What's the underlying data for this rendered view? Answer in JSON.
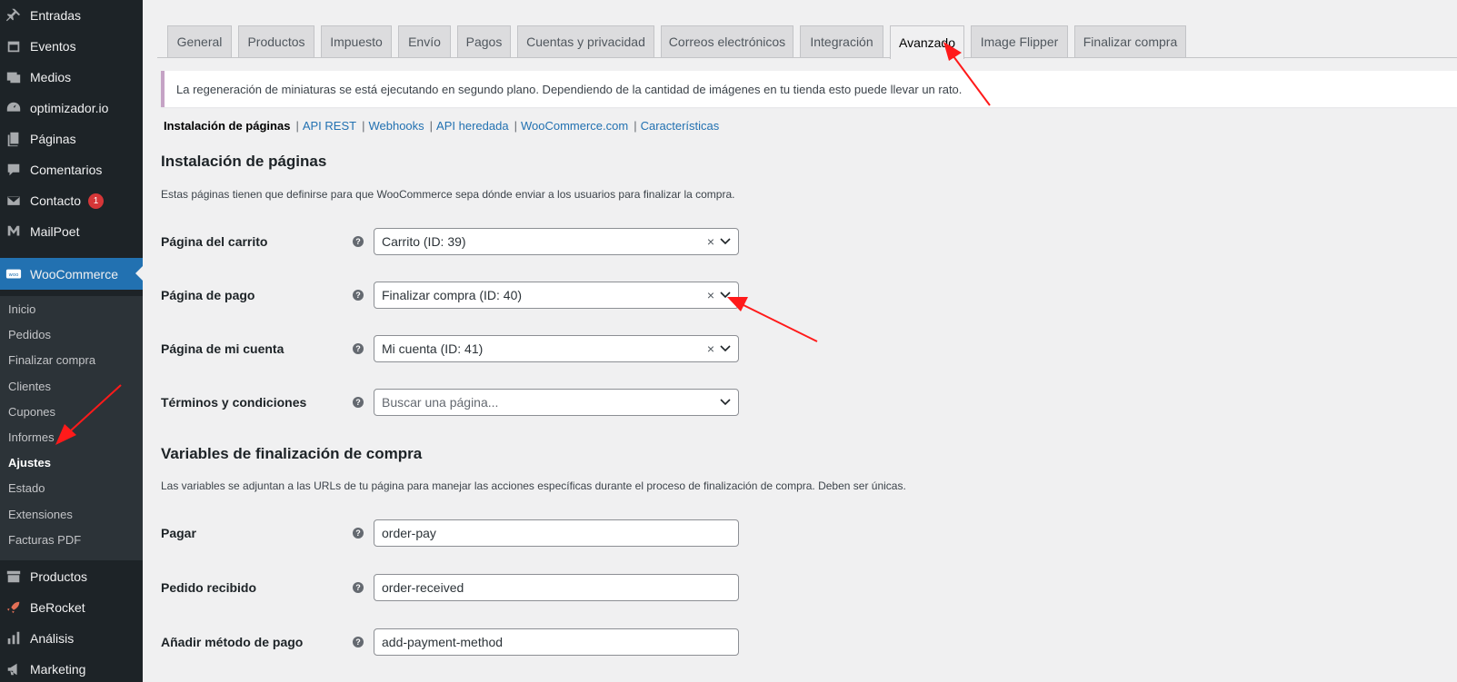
{
  "sidebar": {
    "items": [
      {
        "label": "Entradas",
        "icon": "pin-icon"
      },
      {
        "label": "Eventos",
        "icon": "calendar-icon"
      },
      {
        "label": "Medios",
        "icon": "media-icon"
      },
      {
        "label": "optimizador.io",
        "icon": "gauge-icon"
      },
      {
        "label": "Páginas",
        "icon": "pages-icon"
      },
      {
        "label": "Comentarios",
        "icon": "comment-icon"
      },
      {
        "label": "Contacto",
        "icon": "mail-icon",
        "badge": "1"
      },
      {
        "label": "MailPoet",
        "icon": "mailpoet-icon"
      },
      {
        "label": "WooCommerce",
        "icon": "woo-icon"
      }
    ],
    "submenu": [
      "Inicio",
      "Pedidos",
      "Finalizar compra",
      "Clientes",
      "Cupones",
      "Informes",
      "Ajustes",
      "Estado",
      "Extensiones",
      "Facturas PDF"
    ],
    "bottom_items": [
      {
        "label": "Productos",
        "icon": "archive-icon"
      },
      {
        "label": "BeRocket",
        "icon": "rocket-icon"
      },
      {
        "label": "Análisis",
        "icon": "bar-chart-icon"
      },
      {
        "label": "Marketing",
        "icon": "megaphone-icon"
      }
    ]
  },
  "tabs": [
    "General",
    "Productos",
    "Impuesto",
    "Envío",
    "Pagos",
    "Cuentas y privacidad",
    "Correos electrónicos",
    "Integración",
    "Avanzado",
    "Image Flipper",
    "Finalizar compra"
  ],
  "notice": "La regeneración de miniaturas se está ejecutando en segundo plano. Dependiendo de la cantidad de imágenes en tu tienda esto puede llevar un rato.",
  "subnav": {
    "current": "Instalación de páginas",
    "links": [
      "API REST",
      "Webhooks",
      "API heredada",
      "WooCommerce.com",
      "Características"
    ]
  },
  "pages_section": {
    "title": "Instalación de páginas",
    "desc": "Estas páginas tienen que definirse para que WooCommerce sepa dónde enviar a los usuarios para finalizar la compra.",
    "rows": [
      {
        "label": "Página del carrito",
        "value": "Carrito (ID: 39)"
      },
      {
        "label": "Página de pago",
        "value": "Finalizar compra (ID: 40)"
      },
      {
        "label": "Página de mi cuenta",
        "value": "Mi cuenta (ID: 41)"
      },
      {
        "label": "Términos y condiciones",
        "placeholder": "Buscar una página..."
      }
    ]
  },
  "vars_section": {
    "title": "Variables de finalización de compra",
    "desc": "Las variables se adjuntan a las URLs de tu página para manejar las acciones específicas durante el proceso de finalización de compra. Deben ser únicas.",
    "rows": [
      {
        "label": "Pagar",
        "value": "order-pay"
      },
      {
        "label": "Pedido recibido",
        "value": "order-received"
      },
      {
        "label": "Añadir método de pago",
        "value": "add-payment-method"
      }
    ]
  },
  "help_glyph": "?",
  "clear_glyph": "×",
  "colors": {
    "sidebar": "#1d2327",
    "accent": "#2271b1",
    "annotation_arrow": "#ff1a1a"
  }
}
